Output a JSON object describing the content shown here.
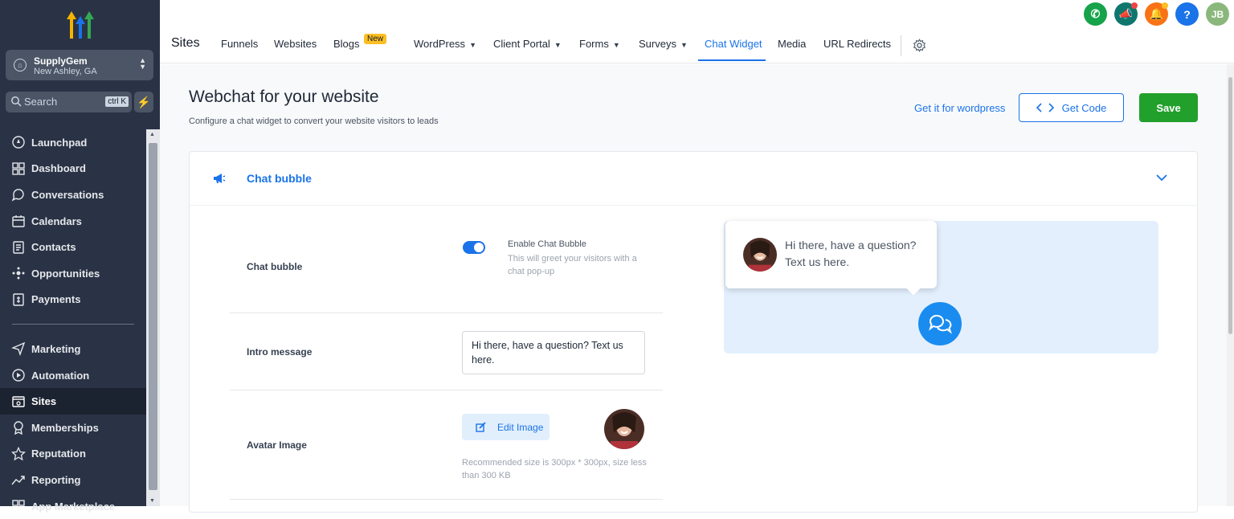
{
  "sidebar": {
    "location": {
      "name": "SupplyGem",
      "sub": "New Ashley, GA"
    },
    "search": {
      "placeholder": "Search",
      "shortcut": "ctrl K"
    },
    "items": [
      {
        "label": "Launchpad",
        "icon": "rocket-icon"
      },
      {
        "label": "Dashboard",
        "icon": "dashboard-icon"
      },
      {
        "label": "Conversations",
        "icon": "chat-icon"
      },
      {
        "label": "Calendars",
        "icon": "calendar-icon"
      },
      {
        "label": "Contacts",
        "icon": "contacts-icon"
      },
      {
        "label": "Opportunities",
        "icon": "opportunities-icon"
      },
      {
        "label": "Payments",
        "icon": "payments-icon"
      },
      {
        "label": "Marketing",
        "icon": "send-icon"
      },
      {
        "label": "Automation",
        "icon": "automation-icon"
      },
      {
        "label": "Sites",
        "icon": "sites-icon"
      },
      {
        "label": "Memberships",
        "icon": "memberships-icon"
      },
      {
        "label": "Reputation",
        "icon": "star-icon"
      },
      {
        "label": "Reporting",
        "icon": "reporting-icon"
      },
      {
        "label": "App Marketplace",
        "icon": "apps-icon"
      }
    ],
    "active": "Sites"
  },
  "topbar": {
    "title": "Sites",
    "tabs": [
      "Funnels",
      "Websites",
      "Blogs",
      "WordPress",
      "Client Portal",
      "Forms",
      "Surveys",
      "Chat Widget",
      "Media",
      "URL Redirects"
    ],
    "new_badge": "New",
    "active_tab": "Chat Widget",
    "user_initials": "JB"
  },
  "page": {
    "title": "Webchat for your website",
    "subtitle": "Configure a chat widget to convert your website visitors to leads",
    "wp_link": "Get it for wordpress",
    "get_code": "Get Code",
    "save": "Save"
  },
  "chat_bubble": {
    "section_title": "Chat bubble",
    "row_chat_bubble": "Chat bubble",
    "toggle_title": "Enable Chat Bubble",
    "toggle_desc": "This will greet your visitors with a chat pop-up",
    "toggle_on": true,
    "row_intro": "Intro message",
    "intro_value": "Hi there, have a question? Text us here.",
    "row_avatar": "Avatar Image",
    "edit_image": "Edit Image",
    "recommend": "Recommended size is 300px * 300px, size less than 300 KB",
    "preview_text": "Hi there, have a question? Text us here."
  },
  "colors": {
    "accent": "#1a73e8",
    "save": "#22a02c",
    "sidebar": "#2a3345"
  }
}
